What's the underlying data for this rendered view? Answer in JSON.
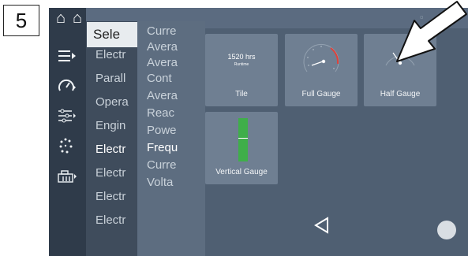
{
  "step_number": "5",
  "left_menu": {
    "header": "Sele",
    "items": [
      {
        "label": "Electr",
        "selected": false
      },
      {
        "label": "Parall",
        "selected": false
      },
      {
        "label": "Opera",
        "selected": false
      },
      {
        "label": "Engin",
        "selected": false
      },
      {
        "label": "Electr",
        "selected": true
      },
      {
        "label": "Electr",
        "selected": false
      },
      {
        "label": "Electr",
        "selected": false
      },
      {
        "label": "Electr",
        "selected": false
      }
    ]
  },
  "parameter_menu": {
    "items": [
      {
        "label": "Curre",
        "selected": false
      },
      {
        "label": "Avera",
        "selected": false
      },
      {
        "label": "Avera",
        "selected": false
      },
      {
        "label": "Cont",
        "selected": false
      },
      {
        "label": "Avera",
        "selected": false
      },
      {
        "label": "Reac",
        "selected": false
      },
      {
        "label": "Powe",
        "selected": false
      },
      {
        "label": "Frequ",
        "selected": true
      },
      {
        "label": "Curre",
        "selected": false
      },
      {
        "label": "Volta",
        "selected": false
      }
    ]
  },
  "display_options": {
    "tile": {
      "value": "1520 hrs",
      "sub": "Runtime",
      "label": "Tile"
    },
    "full_gauge": {
      "label": "Full Gauge"
    },
    "half_gauge": {
      "label": "Half Gauge"
    },
    "vertical_gauge": {
      "label": "Vertical Gauge"
    }
  },
  "colors": {
    "screen_bg": "#4f5f72",
    "rail_bg": "#2f3b4a",
    "tile_bg": "#6f7f92",
    "gauge_green": "#3fae4a",
    "gauge_red": "#e0413a"
  }
}
